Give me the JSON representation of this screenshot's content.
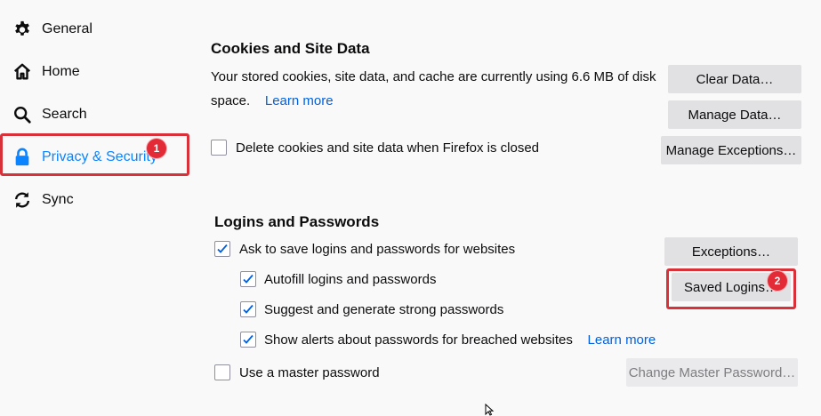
{
  "sidebar": {
    "items": [
      {
        "label": "General",
        "icon": "gear-icon"
      },
      {
        "label": "Home",
        "icon": "home-icon"
      },
      {
        "label": "Search",
        "icon": "search-icon"
      },
      {
        "label": "Privacy & Security",
        "icon": "lock-icon",
        "selected": true
      },
      {
        "label": "Sync",
        "icon": "sync-icon"
      }
    ]
  },
  "annotations": {
    "badge1": "1",
    "badge2": "2",
    "highlight_color": "#d9313a"
  },
  "cookies": {
    "heading": "Cookies and Site Data",
    "description_line1": "Your stored cookies, site data, and cache are currently using 6.6 MB of disk",
    "description_line2": "space.",
    "learn_more": "Learn more",
    "delete_on_close_label": "Delete cookies and site data when Firefox is closed",
    "delete_on_close_checked": false,
    "clear_data_button": "Clear Data…",
    "manage_data_button": "Manage Data…",
    "manage_exceptions_button": "Manage Exceptions…"
  },
  "logins": {
    "heading": "Logins and Passwords",
    "ask_to_save_label": "Ask to save logins and passwords for websites",
    "ask_to_save_checked": true,
    "autofill_label": "Autofill logins and passwords",
    "autofill_checked": true,
    "suggest_label": "Suggest and generate strong passwords",
    "suggest_checked": true,
    "alerts_label": "Show alerts about passwords for breached websites",
    "alerts_checked": true,
    "alerts_learn_more": "Learn more",
    "master_password_label": "Use a master password",
    "master_password_checked": false,
    "exceptions_button": "Exceptions…",
    "saved_logins_button": "Saved Logins…",
    "change_master_button": "Change Master Password…"
  },
  "colors": {
    "accent": "#0a84ff",
    "link": "#0060df",
    "badge": "#e32b37"
  }
}
